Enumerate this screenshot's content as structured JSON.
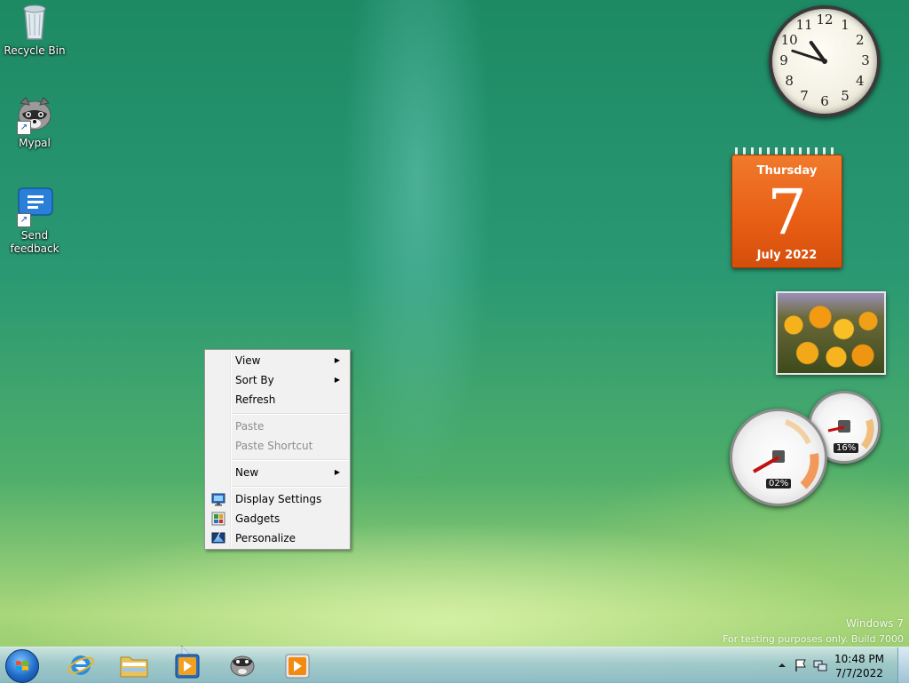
{
  "desktop_icons": [
    {
      "label": "Recycle Bin",
      "icon": "recycle-bin-icon"
    },
    {
      "label": "Mypal",
      "icon": "mypal-raccoon-icon"
    },
    {
      "label": "Send feedback",
      "icon": "feedback-speech-bubble-icon"
    }
  ],
  "gadgets": {
    "clock": {
      "hour": 10,
      "minute": 48,
      "numbers": [
        "12",
        "1",
        "2",
        "3",
        "4",
        "5",
        "6",
        "7",
        "8",
        "9",
        "10",
        "11"
      ]
    },
    "calendar": {
      "day_name": "Thursday",
      "day": "7",
      "month_year": "July 2022"
    },
    "cpu_meter": {
      "cpu": "02%",
      "memory": "16%"
    }
  },
  "context_menu": {
    "items": [
      {
        "label": "View",
        "submenu": true,
        "disabled": false
      },
      {
        "label": "Sort By",
        "submenu": true,
        "disabled": false
      },
      {
        "label": "Refresh",
        "submenu": false,
        "disabled": false
      },
      {
        "label": "Paste",
        "submenu": false,
        "disabled": true
      },
      {
        "label": "Paste Shortcut",
        "submenu": false,
        "disabled": true
      },
      {
        "label": "New",
        "submenu": true,
        "disabled": false
      },
      {
        "label": "Display Settings",
        "submenu": false,
        "disabled": false,
        "icon": "display-settings-icon"
      },
      {
        "label": "Gadgets",
        "submenu": false,
        "disabled": false,
        "icon": "gadgets-icon"
      },
      {
        "label": "Personalize",
        "submenu": false,
        "disabled": false,
        "icon": "personalize-icon"
      }
    ]
  },
  "watermark": {
    "line1": "Windows 7",
    "line2": "For testing purposes only. Build 7000"
  },
  "taskbar": {
    "pinned": [
      {
        "name": "internet-explorer",
        "icon": "internet-explorer-icon"
      },
      {
        "name": "windows-explorer",
        "icon": "folder-icon"
      },
      {
        "name": "media-player",
        "icon": "media-player-icon"
      },
      {
        "name": "mypal",
        "icon": "mypal-raccoon-icon"
      },
      {
        "name": "media-center",
        "icon": "media-center-icon"
      }
    ],
    "clock": {
      "time": "10:48 PM",
      "date": "7/7/2022"
    }
  },
  "colors": {
    "calendar_orange": "#e85d14",
    "taskbar_blue": "#a0c8d8",
    "menu_bg": "#f1f1f1"
  }
}
